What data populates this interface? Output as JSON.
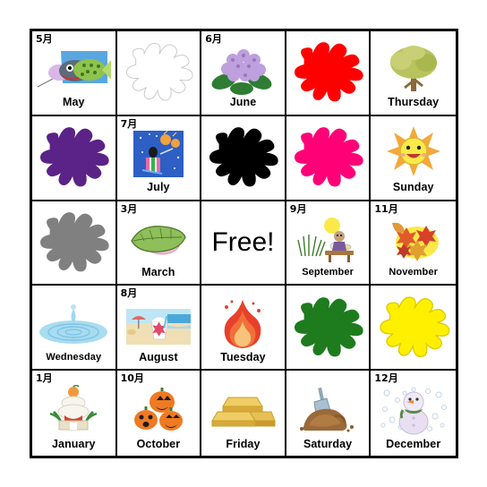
{
  "card": {
    "type": "bingo-card",
    "rows": 5,
    "columns": 5,
    "free_space": {
      "row": 3,
      "column": 3,
      "label": "Free!"
    },
    "border_color": "#000000",
    "background_color": "#ffffff"
  },
  "splat_colors": {
    "outline": "#ffffff",
    "red": "#ff0000",
    "purple": "#5b2287",
    "black": "#000000",
    "pink": "#ff0077",
    "gray": "#808080",
    "green": "#1e7b1e",
    "yellow": "#fff000",
    "yellow_outline": "#e0cc00"
  },
  "cells": [
    {
      "id": "r1c1",
      "jp": "5月",
      "label": "May",
      "art": "koinobori-fish-icon"
    },
    {
      "id": "r1c2",
      "jp": "",
      "label": "",
      "art": "splat-outline-icon"
    },
    {
      "id": "r1c3",
      "jp": "6月",
      "label": "June",
      "art": "hydrangea-flower-icon"
    },
    {
      "id": "r1c4",
      "jp": "",
      "label": "",
      "art": "splat-red-icon"
    },
    {
      "id": "r1c5",
      "jp": "",
      "label": "Thursday",
      "art": "tree-icon"
    },
    {
      "id": "r2c1",
      "jp": "",
      "label": "",
      "art": "splat-purple-icon"
    },
    {
      "id": "r2c2",
      "jp": "7月",
      "label": "July",
      "art": "tanabata-festival-icon"
    },
    {
      "id": "r2c3",
      "jp": "",
      "label": "",
      "art": "splat-black-icon"
    },
    {
      "id": "r2c4",
      "jp": "",
      "label": "",
      "art": "splat-pink-icon"
    },
    {
      "id": "r2c5",
      "jp": "",
      "label": "Sunday",
      "art": "sun-icon"
    },
    {
      "id": "r3c1",
      "jp": "",
      "label": "",
      "art": "splat-gray-icon"
    },
    {
      "id": "r3c2",
      "jp": "3月",
      "label": "March",
      "art": "sakura-mochi-icon"
    },
    {
      "id": "r3c3",
      "jp": "",
      "label": "Free!",
      "art": "free-space"
    },
    {
      "id": "r3c4",
      "jp": "9月",
      "label": "September",
      "art": "moon-viewing-icon"
    },
    {
      "id": "r3c5",
      "jp": "11月",
      "label": "November",
      "art": "autumn-leaves-icon"
    },
    {
      "id": "r4c1",
      "jp": "",
      "label": "Wednesday",
      "art": "water-drop-icon"
    },
    {
      "id": "r4c2",
      "jp": "8月",
      "label": "August",
      "art": "beach-shaved-ice-icon"
    },
    {
      "id": "r4c3",
      "jp": "",
      "label": "Tuesday",
      "art": "fire-icon"
    },
    {
      "id": "r4c4",
      "jp": "",
      "label": "",
      "art": "splat-green-icon"
    },
    {
      "id": "r4c5",
      "jp": "",
      "label": "",
      "art": "splat-yellow-icon"
    },
    {
      "id": "r5c1",
      "jp": "1月",
      "label": "January",
      "art": "kagami-mochi-icon"
    },
    {
      "id": "r5c2",
      "jp": "10月",
      "label": "October",
      "art": "pumpkins-icon"
    },
    {
      "id": "r5c3",
      "jp": "",
      "label": "Friday",
      "art": "gold-bars-icon"
    },
    {
      "id": "r5c4",
      "jp": "",
      "label": "Saturday",
      "art": "dirt-shovel-icon"
    },
    {
      "id": "r5c5",
      "jp": "12月",
      "label": "December",
      "art": "snowman-icon"
    }
  ]
}
